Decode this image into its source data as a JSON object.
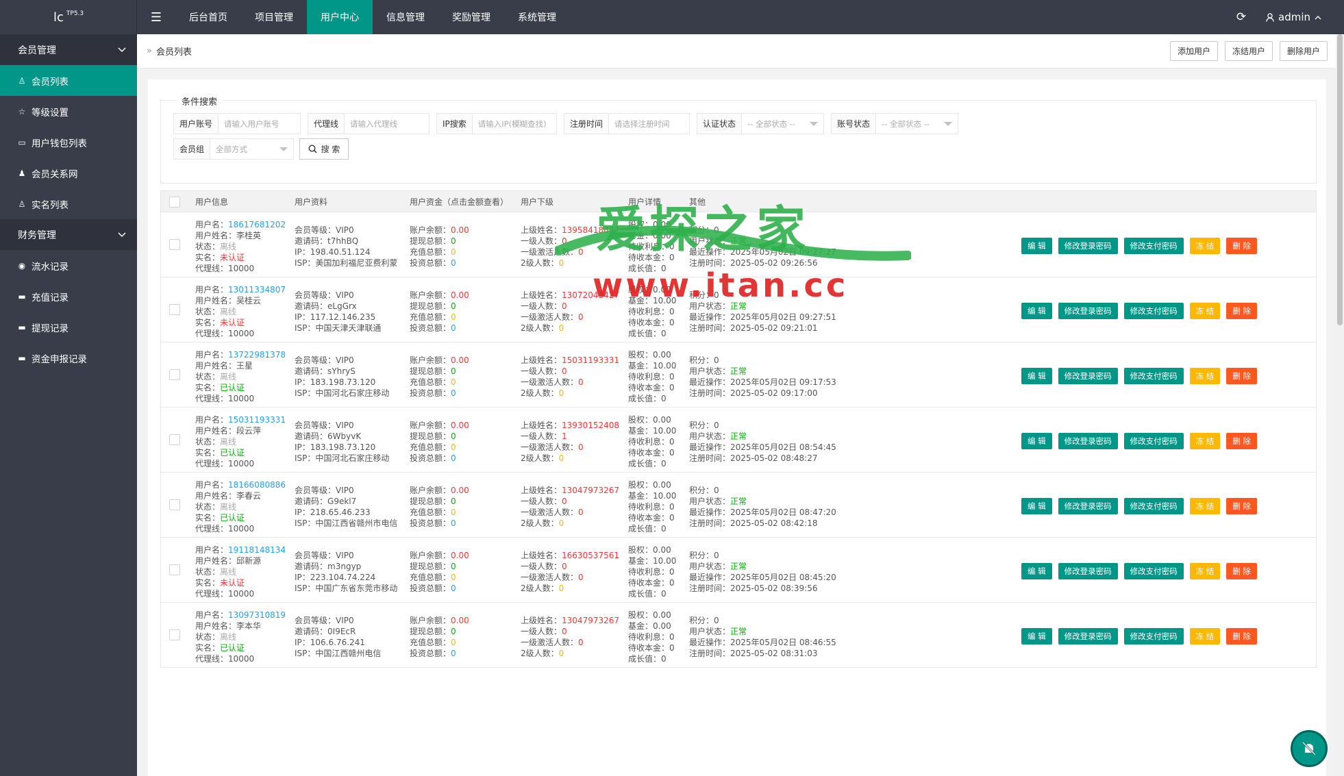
{
  "topbar": {
    "logo": "lc",
    "logo_version": "TP5.3",
    "nav": [
      "后台首页",
      "项目管理",
      "用户中心",
      "信息管理",
      "奖励管理",
      "系统管理"
    ],
    "active_nav": 2,
    "admin": "admin"
  },
  "sidebar": {
    "group1": "会员管理",
    "items1": [
      {
        "label": "会员列表",
        "icon": "user-icon"
      },
      {
        "label": "等级设置",
        "icon": "star-icon"
      },
      {
        "label": "用户钱包列表",
        "icon": "wallet-icon"
      },
      {
        "label": "会员关系网",
        "icon": "users-icon"
      },
      {
        "label": "实名列表",
        "icon": "user-icon"
      }
    ],
    "group2": "财务管理",
    "items2": [
      {
        "label": "流水记录",
        "icon": "flow-icon"
      },
      {
        "label": "充值记录",
        "icon": "card-icon"
      },
      {
        "label": "提现记录",
        "icon": "card-icon"
      },
      {
        "label": "资金申报记录",
        "icon": "card-icon"
      }
    ]
  },
  "breadcrumb": "会员列表",
  "toolbar": {
    "add": "添加用户",
    "freeze": "冻结用户",
    "delete": "删除用户"
  },
  "search": {
    "legend": "条件搜索",
    "account_label": "用户账号",
    "account_ph": "请输入用户账号",
    "agent_label": "代理线",
    "agent_ph": "请输入代理线",
    "ip_label": "IP搜索",
    "ip_ph": "请输入IP(模糊查找)",
    "reg_label": "注册时间",
    "reg_ph": "请选择注册时间",
    "auth_label": "认证状态",
    "auth_value": "-- 全部状态 --",
    "acct_status_label": "账号状态",
    "acct_status_value": "-- 全部状态 --",
    "group_label": "会员组",
    "group_value": "全部方式",
    "button": "搜 索"
  },
  "table": {
    "headers": [
      "用户信息",
      "用户资料",
      "用户资金（点击金额查看）",
      "用户下级",
      "用户详情",
      "其他"
    ],
    "labels": {
      "username": "用户名：",
      "realname": "用户姓名：",
      "status": "状态：",
      "auth": "实名：",
      "agent": "代理线：",
      "level": "会员等级：",
      "invite": "邀请码：",
      "ip": "IP：",
      "isp": "ISP：",
      "balance": "账户余额：",
      "withdraw": "提现总额：",
      "recharge": "充值总额：",
      "invest": "投资总额：",
      "parent": "上级姓名：",
      "l1": "一级人数：",
      "l1act": "一级激活人数：",
      "l2": "2级人数：",
      "equity": "股权：",
      "fund": "基金：",
      "pint": "待收利息：",
      "pcap": "待收本金：",
      "growth": "成长值：",
      "points": "积分：",
      "ustatus": "用户状态：",
      "lastop": "最近操作：",
      "regtime": "注册时间："
    },
    "buttons": {
      "edit": "编 辑",
      "loginpwd": "修改登录密码",
      "paypwd": "修改支付密码",
      "freeze": "冻 结",
      "delete": "删 除"
    },
    "rows": [
      {
        "username": "18617681202",
        "realname": "李桂英",
        "status": "离线",
        "auth": "未认证",
        "agent": "10000",
        "level": "VIP0",
        "invite": "t7hhBQ",
        "ip": "198.40.51.124",
        "isp": "美国加利福尼亚费利蒙",
        "balance": "0.00",
        "withdraw": "0",
        "recharge": "0",
        "invest": "0",
        "parent": "13958418887",
        "l1": "0",
        "l1act": "0",
        "l2": "0",
        "equity": "0.00",
        "fund": "0.00",
        "pint": "0",
        "pcap": "0",
        "growth": "0",
        "points": "0",
        "ustatus": "正常",
        "lastop": "2025年05月02日 09:27:27",
        "regtime": "2025-05-02 09:26:56"
      },
      {
        "username": "13011334807",
        "realname": "吴桂云",
        "status": "离线",
        "auth": "未认证",
        "agent": "10000",
        "level": "VIP0",
        "invite": "eLgGrx",
        "ip": "117.12.146.235",
        "isp": "中国天津天津联通",
        "balance": "0.00",
        "withdraw": "0",
        "recharge": "0",
        "invest": "0",
        "parent": "13072043427",
        "l1": "0",
        "l1act": "0",
        "l2": "0",
        "equity": "0.00",
        "fund": "10.00",
        "pint": "0",
        "pcap": "0",
        "growth": "0",
        "points": "0",
        "ustatus": "正常",
        "lastop": "2025年05月02日 09:27:51",
        "regtime": "2025-05-02 09:21:01"
      },
      {
        "username": "13722981378",
        "realname": "王星",
        "status": "离线",
        "auth": "已认证",
        "agent": "10000",
        "level": "VIP0",
        "invite": "sYhryS",
        "ip": "183.198.73.120",
        "isp": "中国河北石家庄移动",
        "balance": "0.00",
        "withdraw": "0",
        "recharge": "0",
        "invest": "0",
        "parent": "15031193331",
        "l1": "0",
        "l1act": "0",
        "l2": "0",
        "equity": "0.00",
        "fund": "10.00",
        "pint": "0",
        "pcap": "0",
        "growth": "0",
        "points": "0",
        "ustatus": "正常",
        "lastop": "2025年05月02日 09:17:53",
        "regtime": "2025-05-02 09:17:00"
      },
      {
        "username": "15031193331",
        "realname": "段云萍",
        "status": "离线",
        "auth": "已认证",
        "agent": "10000",
        "level": "VIP0",
        "invite": "6WbyvK",
        "ip": "183.198.73.120",
        "isp": "中国河北石家庄移动",
        "balance": "0.00",
        "withdraw": "0",
        "recharge": "0",
        "invest": "0",
        "parent": "13930152408",
        "l1": "1",
        "l1act": "0",
        "l2": "0",
        "equity": "0.00",
        "fund": "10.00",
        "pint": "0",
        "pcap": "0",
        "growth": "0",
        "points": "0",
        "ustatus": "正常",
        "lastop": "2025年05月02日 08:54:45",
        "regtime": "2025-05-02 08:48:27"
      },
      {
        "username": "18166080886",
        "realname": "李春云",
        "status": "离线",
        "auth": "已认证",
        "agent": "10000",
        "level": "VIP0",
        "invite": "G9ekl7",
        "ip": "218.65.46.233",
        "isp": "中国江西省赣州市电信",
        "balance": "0.00",
        "withdraw": "0",
        "recharge": "0",
        "invest": "0",
        "parent": "13047973267",
        "l1": "0",
        "l1act": "0",
        "l2": "0",
        "equity": "0.00",
        "fund": "10.00",
        "pint": "0",
        "pcap": "0",
        "growth": "0",
        "points": "0",
        "ustatus": "正常",
        "lastop": "2025年05月02日 08:47:20",
        "regtime": "2025-05-02 08:42:18"
      },
      {
        "username": "19118148134",
        "realname": "邱新源",
        "status": "离线",
        "auth": "未认证",
        "agent": "10000",
        "level": "VIP0",
        "invite": "m3ngyp",
        "ip": "223.104.74.224",
        "isp": "中国广东省东莞市移动",
        "balance": "0.00",
        "withdraw": "0",
        "recharge": "0",
        "invest": "0",
        "parent": "16630537561",
        "l1": "0",
        "l1act": "0",
        "l2": "0",
        "equity": "0.00",
        "fund": "10.00",
        "pint": "0",
        "pcap": "0",
        "growth": "0",
        "points": "0",
        "ustatus": "正常",
        "lastop": "2025年05月02日 08:45:20",
        "regtime": "2025-05-02 08:39:56"
      },
      {
        "username": "13097310819",
        "realname": "李本华",
        "status": "离线",
        "auth": "已认证",
        "agent": "10000",
        "level": "VIP0",
        "invite": "0I9EcR",
        "ip": "106.6.76.241",
        "isp": "中国江西赣州电信",
        "balance": "0.00",
        "withdraw": "0",
        "recharge": "0",
        "invest": "0",
        "parent": "13047973267",
        "l1": "0",
        "l1act": "0",
        "l2": "0",
        "equity": "0.00",
        "fund": "0.00",
        "pint": "0",
        "pcap": "0",
        "growth": "0",
        "points": "0",
        "ustatus": "正常",
        "lastop": "2025年05月02日 08:46:55",
        "regtime": "2025-05-02 08:31:03"
      }
    ]
  },
  "watermark": {
    "top": "爱探之家",
    "bottom": "www.itan.cc"
  },
  "colors": {
    "topbar": "#393d49",
    "accent": "#009688",
    "link": "#1e9fff",
    "warn": "#ffb800",
    "danger": "#ff5722",
    "alert": "#ff3333",
    "ok": "#00b000"
  }
}
